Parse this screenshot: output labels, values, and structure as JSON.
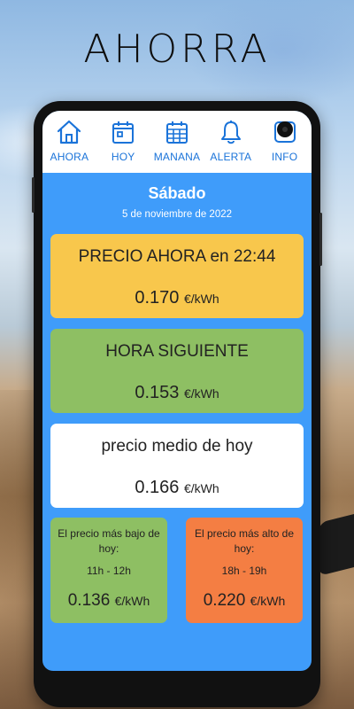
{
  "headline": "AHORRA",
  "nav": {
    "items": [
      {
        "label": "AHORA",
        "icon": "home-icon"
      },
      {
        "label": "HOY",
        "icon": "calendar-day-icon"
      },
      {
        "label": "MANANA",
        "icon": "calendar-grid-icon"
      },
      {
        "label": "ALERTA",
        "icon": "bell-icon"
      },
      {
        "label": "INFO",
        "icon": "camera-icon"
      }
    ]
  },
  "day": {
    "title": "Sábado",
    "date": "5 de noviembre de 2022"
  },
  "cards": {
    "now": {
      "title": "PRECIO AHORA en 22:44",
      "price": "0.170",
      "unit": "€/kWh"
    },
    "next": {
      "title": "HORA SIGUIENTE",
      "price": "0.153",
      "unit": "€/kWh"
    },
    "average": {
      "title": "precio medio de hoy",
      "price": "0.166",
      "unit": "€/kWh"
    },
    "low": {
      "title": "El precio más bajo de hoy:",
      "range": "11h - 12h",
      "price": "0.136",
      "unit": "€/kWh"
    },
    "high": {
      "title": "El precio más alto de hoy:",
      "range": "18h - 19h",
      "price": "0.220",
      "unit": "€/kWh"
    }
  },
  "colors": {
    "screen_bg": "#3f9cfa",
    "nav_accent": "#1a73d9",
    "now_card": "#f8c74c",
    "next_card": "#8ebf63",
    "avg_card": "#ffffff",
    "low_card": "#8ebf63",
    "high_card": "#f47e43"
  }
}
